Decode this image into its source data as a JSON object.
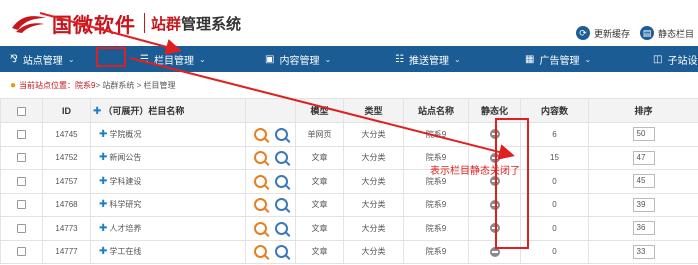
{
  "header": {
    "brand": "国微软件",
    "subtitle_highlight": "站群",
    "subtitle_rest": "管理系统",
    "refresh_label": "更新缓存",
    "static_label": "静态栏目"
  },
  "nav": {
    "items": [
      {
        "label": "站点管理",
        "icon": "sitemap-icon"
      },
      {
        "label": "栏目管理",
        "icon": "list-icon"
      },
      {
        "label": "内容管理",
        "icon": "content-icon"
      },
      {
        "label": "推送管理",
        "icon": "push-icon"
      },
      {
        "label": "广告管理",
        "icon": "ad-icon"
      },
      {
        "label": "子站设置",
        "icon": "substation-icon"
      }
    ]
  },
  "breadcrumb": {
    "prefix": "当前站点位置：",
    "site": "院系9",
    "path": " > 站群系统 > 栏目管理"
  },
  "table": {
    "headers": {
      "id": "ID",
      "name": "（可展开）栏目名称",
      "template": "模型",
      "type": "类型",
      "site": "站点名称",
      "static": "静态化",
      "count": "内容数",
      "sort": "排序"
    },
    "rows": [
      {
        "id": "14745",
        "name": "学院概况",
        "template": "单网页",
        "type": "大分类",
        "site": "院系9",
        "count": "6",
        "sort": "50"
      },
      {
        "id": "14752",
        "name": "新闻公告",
        "template": "文章",
        "type": "大分类",
        "site": "院系9",
        "count": "15",
        "sort": "47"
      },
      {
        "id": "14757",
        "name": "学科建设",
        "template": "文章",
        "type": "大分类",
        "site": "院系9",
        "count": "0",
        "sort": "45"
      },
      {
        "id": "14768",
        "name": "科学研究",
        "template": "文章",
        "type": "大分类",
        "site": "院系9",
        "count": "0",
        "sort": "39"
      },
      {
        "id": "14773",
        "name": "人才培养",
        "template": "文章",
        "type": "大分类",
        "site": "院系9",
        "count": "0",
        "sort": "36"
      },
      {
        "id": "14777",
        "name": "学工在线",
        "template": "文章",
        "type": "大分类",
        "site": "院系9",
        "count": "0",
        "sort": "33"
      }
    ]
  },
  "annotation": {
    "text": "表示栏目静态关闭了",
    "color": "#e02020"
  }
}
